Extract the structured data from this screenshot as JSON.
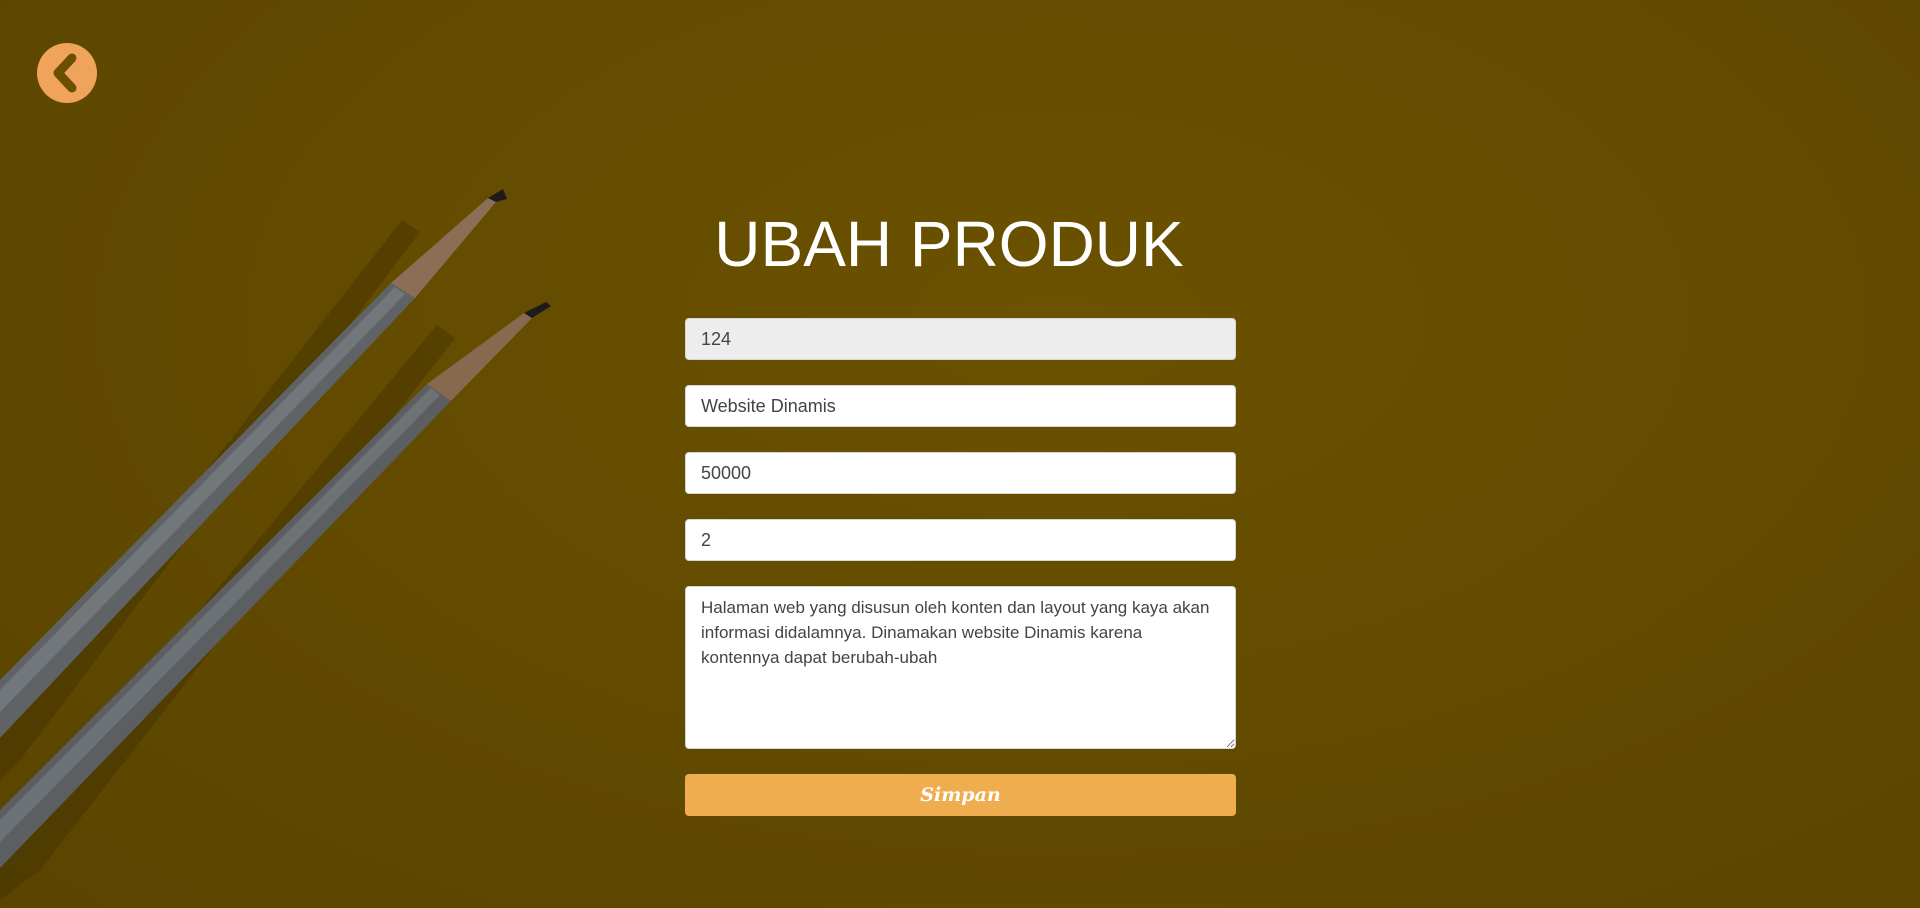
{
  "back": {
    "icon": "chevron-left-icon",
    "color": "#f0a35a",
    "icon_color": "#6a4f00"
  },
  "page": {
    "title": "UBAH PRODUK",
    "background_color": "#634b00"
  },
  "form": {
    "product_id": "124",
    "product_name": "Website Dinamis",
    "price": "50000",
    "stock": "2",
    "description": "Halaman web yang disusun oleh konten dan layout yang kaya akan informasi didalamnya. Dinamakan website Dinamis karena kontennya dapat berubah-ubah",
    "submit_label": "Simpan",
    "submit_color": "#efad4f"
  }
}
